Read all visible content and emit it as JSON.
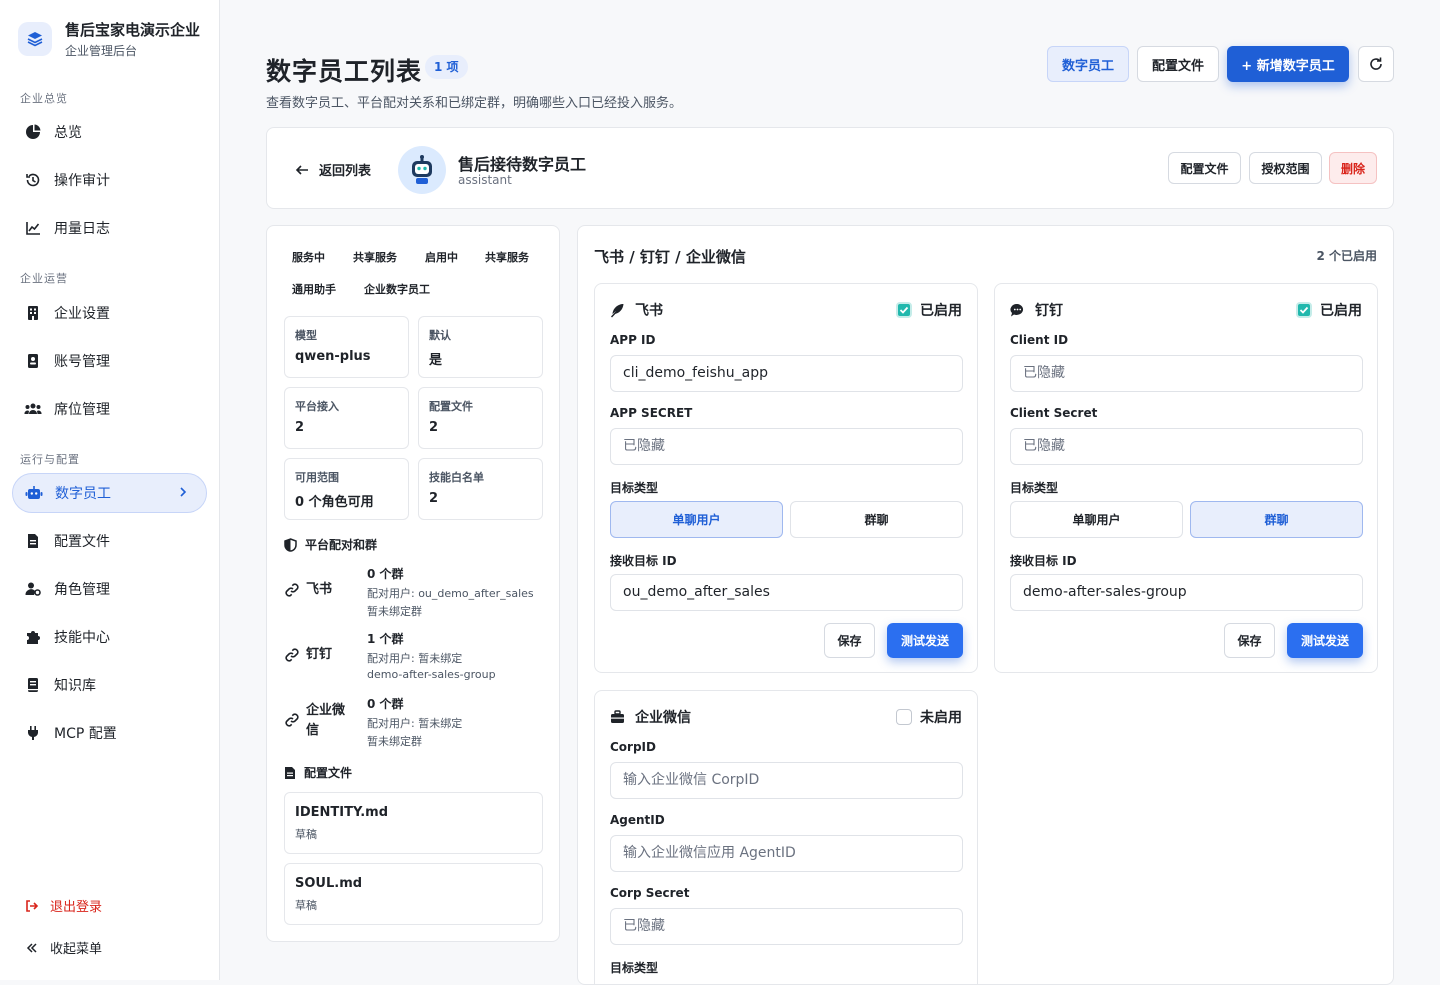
{
  "brand": {
    "title": "售后宝家电演示企业",
    "subtitle": "企业管理后台"
  },
  "sidebar": {
    "sections": [
      "企业总览",
      "企业运营",
      "运行与配置"
    ],
    "items": [
      {
        "label": "总览",
        "icon": "pie-chart-icon"
      },
      {
        "label": "操作审计",
        "icon": "history-icon"
      },
      {
        "label": "用量日志",
        "icon": "line-chart-icon"
      },
      {
        "label": "企业设置",
        "icon": "building-icon"
      },
      {
        "label": "账号管理",
        "icon": "id-card-icon"
      },
      {
        "label": "席位管理",
        "icon": "users-icon"
      },
      {
        "label": "数字员工",
        "icon": "robot-icon"
      },
      {
        "label": "配置文件",
        "icon": "file-icon"
      },
      {
        "label": "角色管理",
        "icon": "user-gear-icon"
      },
      {
        "label": "技能中心",
        "icon": "puzzle-icon"
      },
      {
        "label": "知识库",
        "icon": "book-icon"
      },
      {
        "label": "MCP 配置",
        "icon": "plug-icon"
      }
    ],
    "logout": "退出登录",
    "collapse": "收起菜单"
  },
  "header": {
    "title": "数字员工列表",
    "count_badge": "1 项",
    "description": "查看数字员工、平台配对关系和已绑定群，明确哪些入口已经投入服务。",
    "btn_employees": "数字员工",
    "btn_config": "配置文件",
    "btn_add": "+ 新增数字员工"
  },
  "employee": {
    "back": "返回列表",
    "name": "售后接待数字员工",
    "role": "assistant",
    "btn_config": "配置文件",
    "btn_scope": "授权范围",
    "btn_delete": "删除"
  },
  "left": {
    "tags": [
      "服务中",
      "共享服务",
      "启用中",
      "共享服务",
      "通用助手",
      "企业数字员工"
    ],
    "info": [
      {
        "label": "模型",
        "value": "qwen-plus"
      },
      {
        "label": "默认",
        "value": "是"
      },
      {
        "label": "平台接入",
        "value": "2"
      },
      {
        "label": "配置文件",
        "value": "2"
      },
      {
        "label": "可用范围",
        "value": "0 个角色可用"
      },
      {
        "label": "技能白名单",
        "value": "2"
      }
    ],
    "pairing_title": "平台配对和群",
    "platforms": [
      {
        "name": "飞书",
        "count": "0 个群",
        "lines": [
          "配对用户: ou_demo_after_sales",
          "暂未绑定群"
        ]
      },
      {
        "name": "钉钉",
        "count": "1 个群",
        "lines": [
          "配对用户: 暂未绑定",
          "demo-after-sales-group"
        ]
      },
      {
        "name": "企业微信",
        "count": "0 个群",
        "lines": [
          "配对用户: 暂未绑定",
          "暂未绑定群"
        ]
      }
    ],
    "files_title": "配置文件",
    "files": [
      {
        "name": "IDENTITY.md",
        "status": "草稿"
      },
      {
        "name": "SOUL.md",
        "status": "草稿"
      }
    ]
  },
  "right": {
    "title": "飞书 / 钉钉 / 企业微信",
    "enabled_count": "2 个已启用",
    "target_type_label": "目标类型",
    "target_id_label": "接收目标 ID",
    "opt_user": "单聊用户",
    "opt_group": "群聊",
    "save": "保存",
    "test": "测试发送",
    "feishu": {
      "name": "飞书",
      "status": "已启用",
      "f1_label": "APP ID",
      "f1_value": "cli_demo_feishu_app",
      "f2_label": "APP SECRET",
      "f2_value": "已隐藏",
      "target_value": "ou_demo_after_sales"
    },
    "dingtalk": {
      "name": "钉钉",
      "status": "已启用",
      "f1_label": "Client ID",
      "f1_value": "已隐藏",
      "f2_label": "Client Secret",
      "f2_value": "已隐藏",
      "target_value": "demo-after-sales-group"
    },
    "wecom": {
      "name": "企业微信",
      "status": "未启用",
      "f1_label": "CorpID",
      "f1_placeholder": "输入企业微信 CorpID",
      "f2_label": "AgentID",
      "f2_placeholder": "输入企业微信应用 AgentID",
      "f3_label": "Corp Secret",
      "f3_value": "已隐藏"
    }
  },
  "colors": {
    "accent": "#1f5fd6",
    "accent_soft": "#e8eefc",
    "danger": "#d9251c",
    "check": "#21b8ad"
  }
}
